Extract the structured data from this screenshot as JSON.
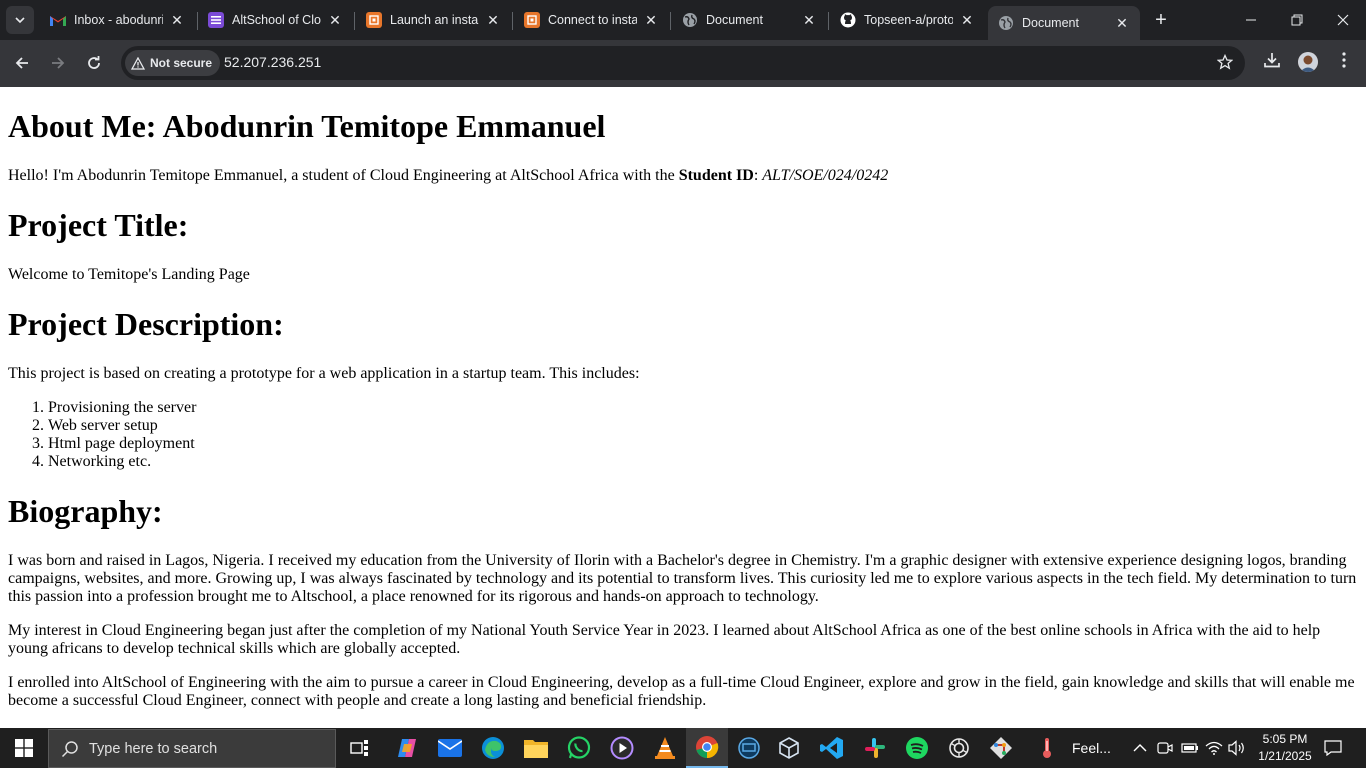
{
  "browser": {
    "tabs": [
      {
        "title": "Inbox - abodunrin",
        "icon": "gmail-icon",
        "color": "#ea4335"
      },
      {
        "title": "AltSchool of Cloud",
        "icon": "list-icon",
        "color": "#7b4bd6"
      },
      {
        "title": "Launch an instance",
        "icon": "aws-icon",
        "color": "#e7762b"
      },
      {
        "title": "Connect to instance",
        "icon": "aws-icon",
        "color": "#e7762b"
      },
      {
        "title": "Document",
        "icon": "globe-icon",
        "color": "#9aa0a6"
      },
      {
        "title": "Topseen-a/proto",
        "icon": "github-icon",
        "color": "#ffffff"
      },
      {
        "title": "Document",
        "icon": "globe-icon",
        "color": "#9aa0a6",
        "active": true
      }
    ],
    "security_label": "Not secure",
    "url": "52.207.236.251"
  },
  "page": {
    "about_heading": "About Me: Abodunrin Temitope Emmanuel",
    "intro_text": "Hello! I'm Abodunrin Temitope Emmanuel, a student of Cloud Engineering at AltSchool Africa with the ",
    "student_id_label": "Student ID",
    "student_id_sep": ": ",
    "student_id_value": "ALT/SOE/024/0242",
    "project_title_heading": "Project Title:",
    "project_title_text": "Welcome to Temitope's Landing Page",
    "project_desc_heading": "Project Description:",
    "project_desc_text": "This project is based on creating a prototype for a web application in a startup team. This includes:",
    "project_items": [
      "Provisioning the server",
      "Web server setup",
      "Html page deployment",
      "Networking etc."
    ],
    "bio_heading": "Biography:",
    "bio_paragraphs": [
      "I was born and raised in Lagos, Nigeria. I received my education from the University of Ilorin with a Bachelor's degree in Chemistry. I'm a graphic designer with extensive experience designing logos, branding campaigns, websites, and more. Growing up, I was always fascinated by technology and its potential to transform lives. This curiosity led me to explore various aspects in the tech field. My determination to turn this passion into a profession brought me to Altschool, a place renowned for its rigorous and hands-on approach to technology.",
      "My interest in Cloud Engineering began just after the completion of my National Youth Service Year in 2023. I learned about AltSchool Africa as one of the best online schools in Africa with the aid to help young africans to develop technical skills which are globally accepted.",
      "I enrolled into AltSchool of Engineering with the aim to pursue a career in Cloud Engineering, develop as a full-time Cloud Engineer, explore and grow in the field, gain knowledge and skills that will enable me become a successful Cloud Engineer, connect with people and create a long lasting and beneficial friendship."
    ]
  },
  "taskbar": {
    "search_placeholder": "Type here to search",
    "weather_text": "Feel...",
    "time": "5:05 PM",
    "date": "1/21/2025",
    "apps": [
      "task-view",
      "copilot",
      "mail",
      "edge",
      "file-explorer",
      "whatsapp",
      "media-player",
      "vlc",
      "chrome",
      "remote-desktop",
      "virtualbox",
      "vscode",
      "slack",
      "spotify",
      "chatgpt",
      "git"
    ]
  }
}
